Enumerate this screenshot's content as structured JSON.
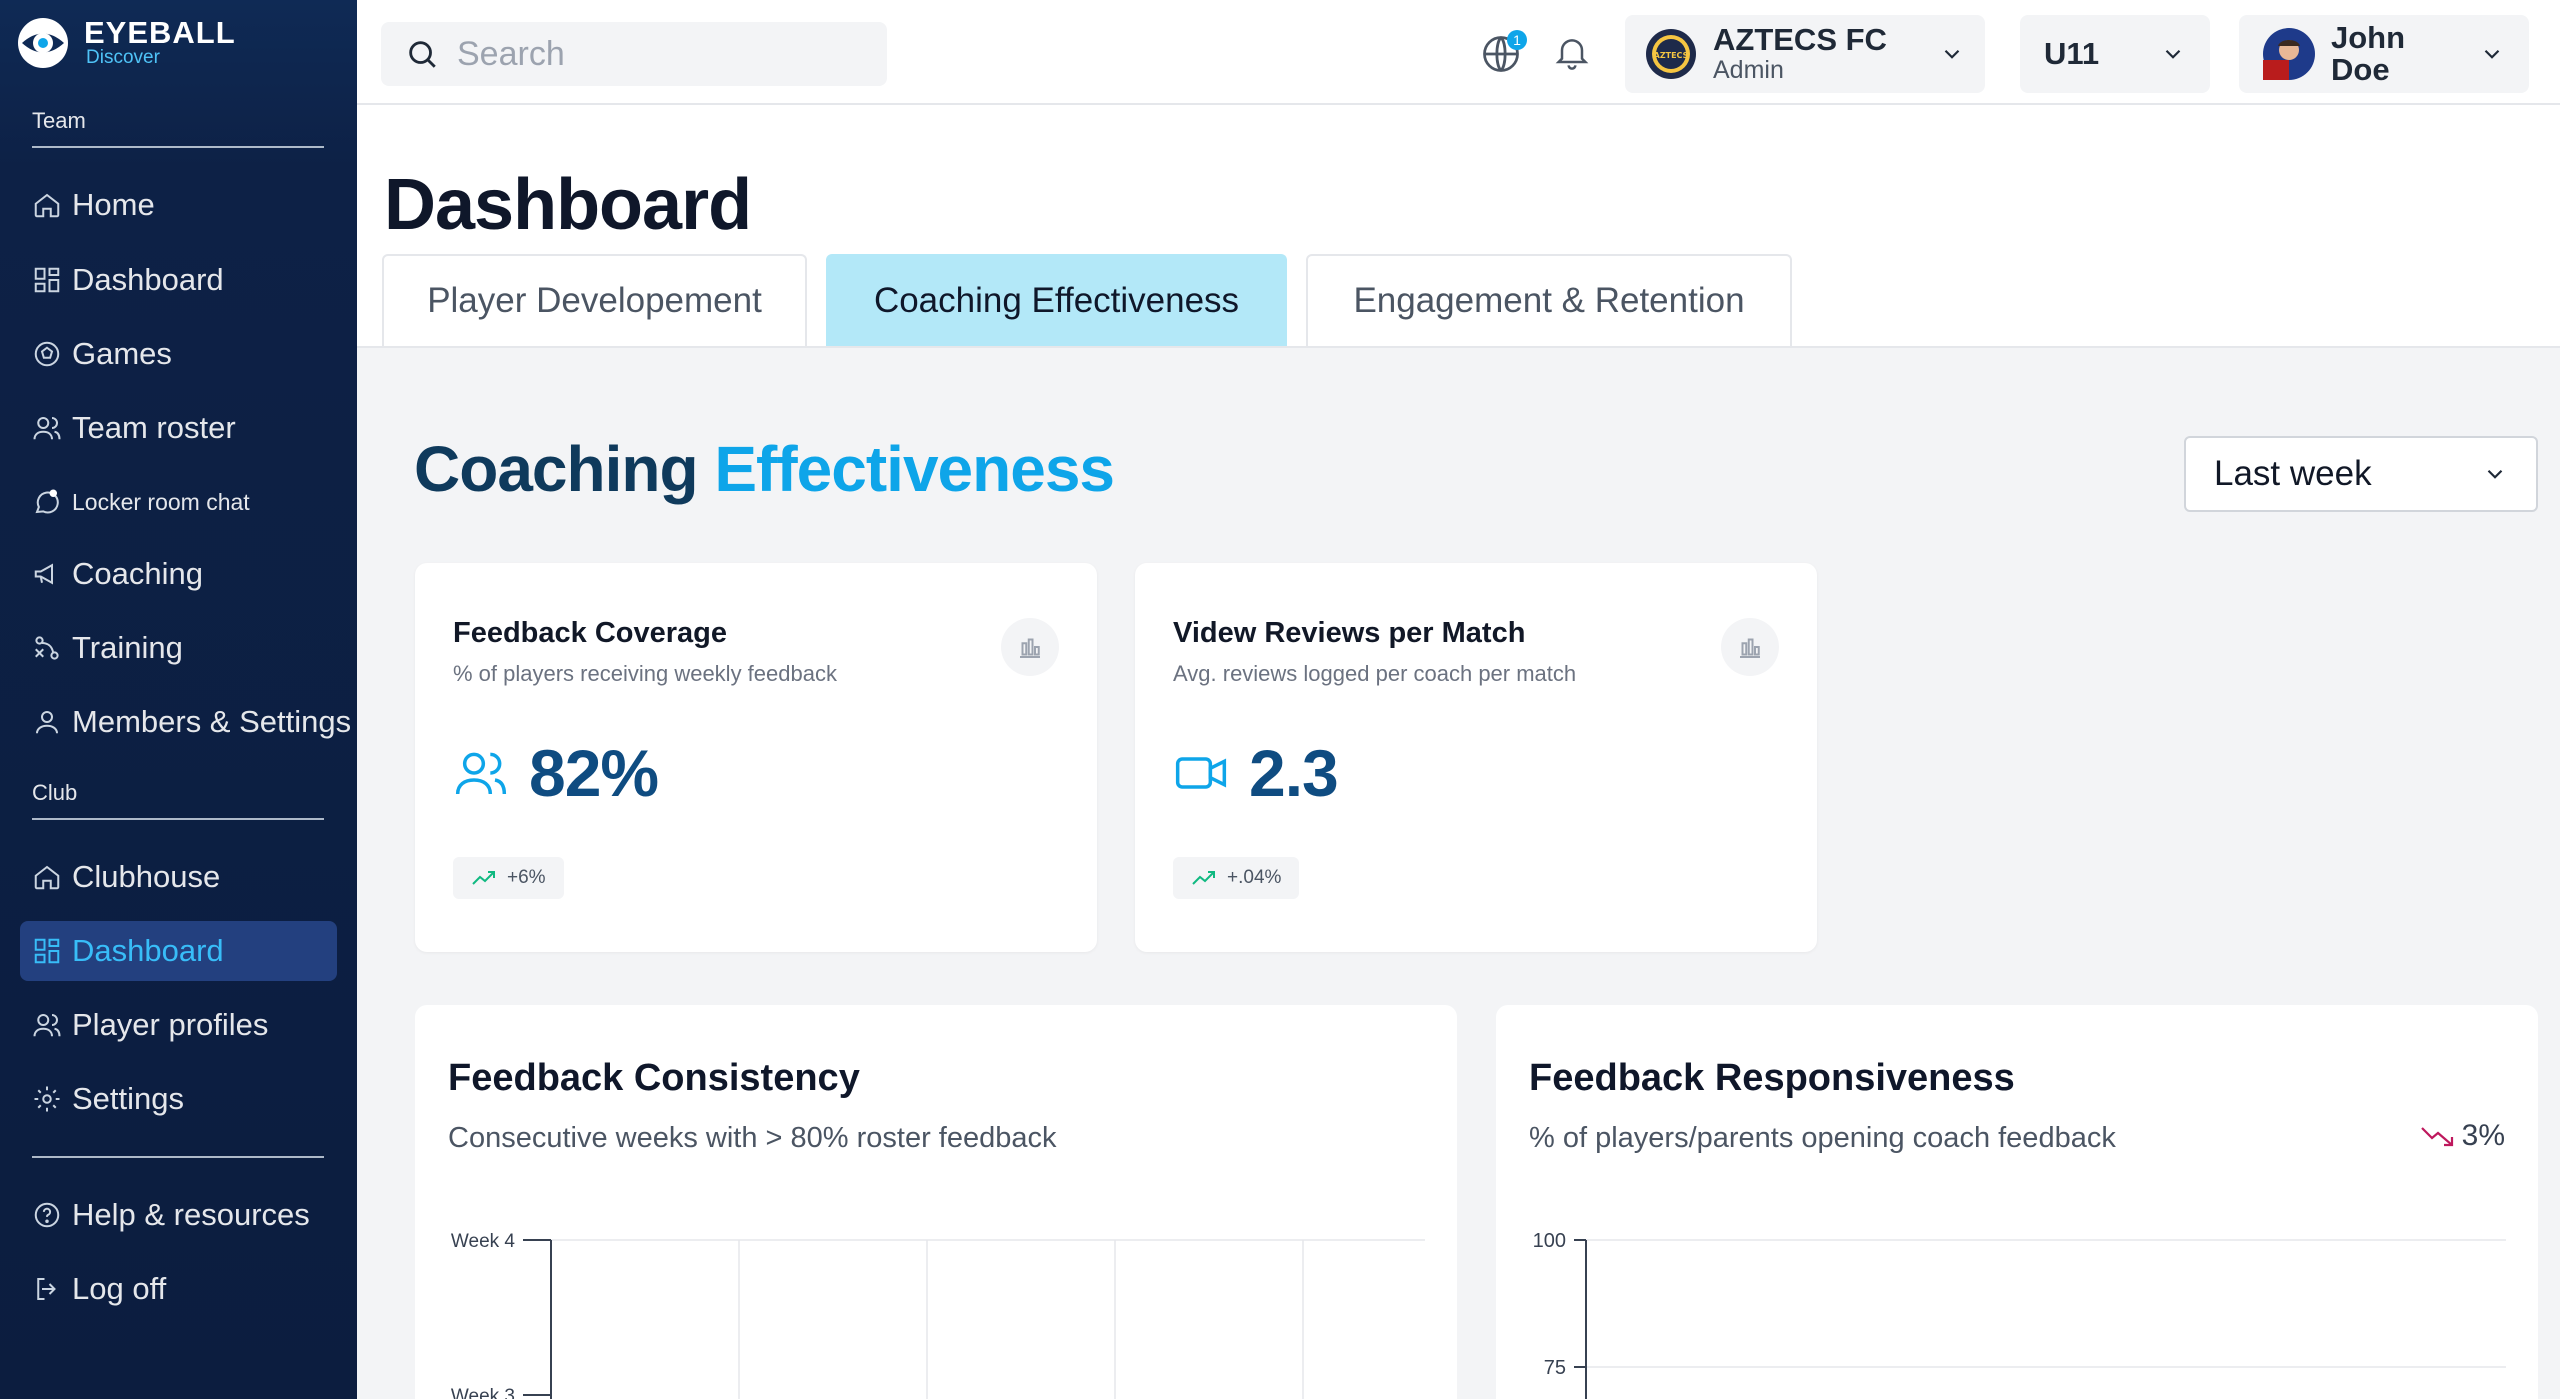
{
  "brand": {
    "name": "EYEBALL",
    "sub": "Discover"
  },
  "sidebar": {
    "team_label": "Team",
    "team_items": [
      {
        "label": "Home",
        "icon": "home-icon"
      },
      {
        "label": "Dashboard",
        "icon": "grid-icon"
      },
      {
        "label": "Games",
        "icon": "ball-icon"
      },
      {
        "label": "Team roster",
        "icon": "users-icon"
      },
      {
        "label": "Locker room chat",
        "icon": "chat-icon"
      },
      {
        "label": "Coaching",
        "icon": "megaphone-icon"
      },
      {
        "label": "Training",
        "icon": "drills-icon"
      },
      {
        "label": "Members & Settings",
        "icon": "user-icon"
      }
    ],
    "club_label": "Club",
    "club_items": [
      {
        "label": "Clubhouse",
        "icon": "home-icon"
      },
      {
        "label": "Dashboard",
        "icon": "grid-icon",
        "active": true
      },
      {
        "label": "Player profiles",
        "icon": "users-icon"
      },
      {
        "label": "Settings",
        "icon": "gear-icon"
      }
    ],
    "footer_items": [
      {
        "label": "Help & resources",
        "icon": "help-icon"
      },
      {
        "label": "Log off",
        "icon": "logout-icon"
      }
    ]
  },
  "topbar": {
    "search_placeholder": "Search",
    "notification_count": "1",
    "club": {
      "name": "AZTECS FC",
      "role": "Admin",
      "logo_text": "AZTECS"
    },
    "team": "U11",
    "user": "John Doe"
  },
  "page": {
    "title": "Dashboard",
    "tabs": [
      "Player Developement",
      "Coaching Effectiveness",
      "Engagement & Retention"
    ],
    "active_tab": 1,
    "section_title_a": "Coaching ",
    "section_title_b": "Effectiveness",
    "period": "Last week"
  },
  "kpis": [
    {
      "title": "Feedback Coverage",
      "sub": "% of players receiving weekly feedback",
      "value": "82%",
      "trend": "+6%",
      "icon": "users-icon"
    },
    {
      "title": "Videw Reviews per Match",
      "sub": "Avg. reviews logged per coach per match",
      "value": "2.3",
      "trend": "+.04%",
      "icon": "video-icon"
    }
  ],
  "cards": [
    {
      "title": "Feedback Consistency",
      "sub": "Consecutive weeks with > 80% roster feedback",
      "y_ticks": [
        "Week 4",
        "Week 3"
      ]
    },
    {
      "title": "Feedback Responsiveness",
      "sub": "% of players/parents opening coach feedback",
      "badge": "3%",
      "y_ticks": [
        "100",
        "75"
      ]
    }
  ],
  "colors": {
    "sidebar": "#0c1d3f",
    "accent": "#0ea5e9",
    "active_tab": "#b3e8f8",
    "kpi_value": "#0f4c81",
    "trend_up": "#10b981",
    "trend_down": "#be185d"
  }
}
